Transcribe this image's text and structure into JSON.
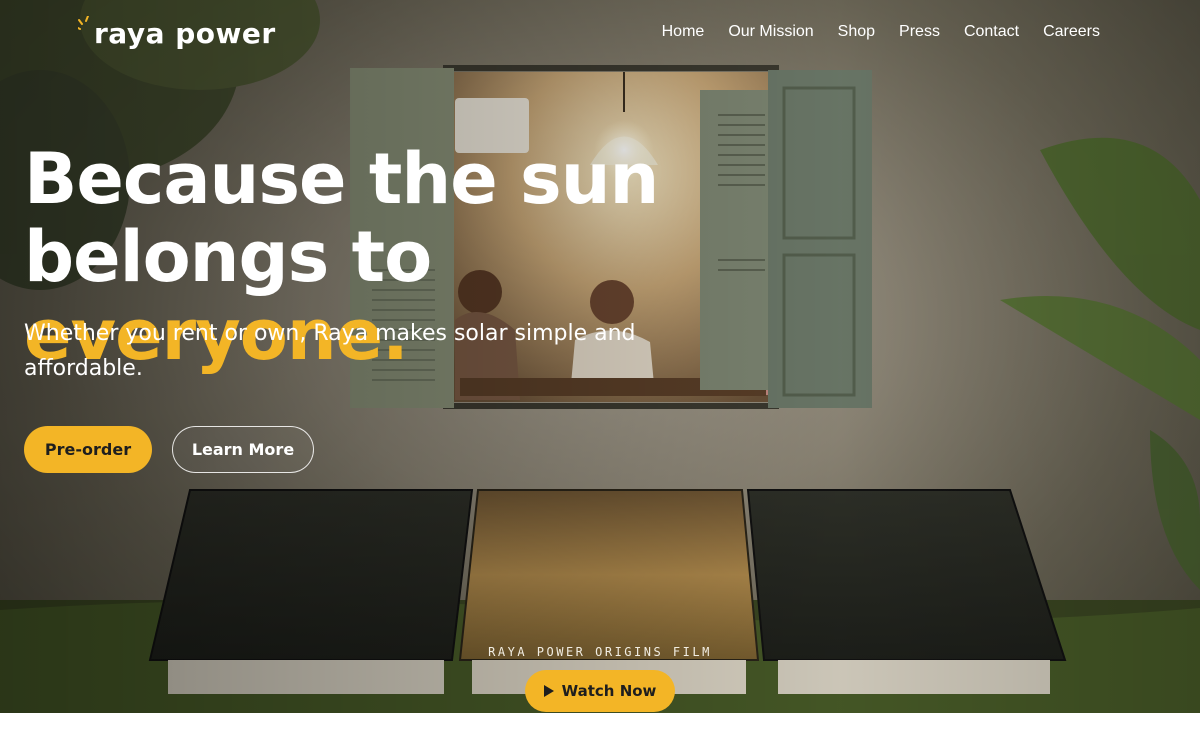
{
  "header": {
    "logo_text": "raya power",
    "nav": [
      {
        "label": "Home"
      },
      {
        "label": "Our Mission"
      },
      {
        "label": "Shop"
      },
      {
        "label": "Press"
      },
      {
        "label": "Contact"
      },
      {
        "label": "Careers"
      }
    ]
  },
  "hero": {
    "headline_line1": "Because the sun",
    "headline_line2_prefix": "belongs to ",
    "headline_accent": "everyone.",
    "subtitle": "Whether you rent or own, Raya makes solar simple and affordable.",
    "primary_cta": "Pre-order",
    "secondary_cta": "Learn More",
    "film_caption": "RAYA POWER ORIGINS FILM",
    "watch_cta": "Watch Now"
  },
  "colors": {
    "accent": "#f3b526",
    "text_light": "#ffffff",
    "button_text_dark": "#1e1e1e"
  },
  "icons": [
    "sun-rays-icon",
    "play-icon"
  ]
}
